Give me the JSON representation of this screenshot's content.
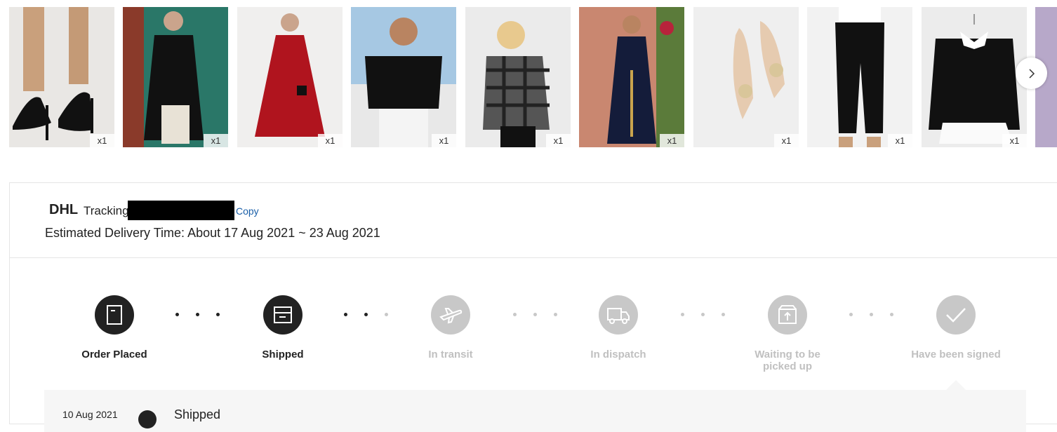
{
  "products": [
    {
      "name": "heels-black",
      "qty": "x1"
    },
    {
      "name": "coat-black-dotted",
      "qty": "x1"
    },
    {
      "name": "cape-dress-red",
      "qty": "x1"
    },
    {
      "name": "pearl-top-black",
      "qty": "x1"
    },
    {
      "name": "plaid-shirt",
      "qty": "x1"
    },
    {
      "name": "embroidered-dress-navy",
      "qty": "x1"
    },
    {
      "name": "pearl-flats",
      "qty": "x1"
    },
    {
      "name": "pants-black",
      "qty": "x1"
    },
    {
      "name": "collar-blouse",
      "qty": "x1"
    }
  ],
  "tracking": {
    "carrier": "DHL",
    "label": "Tracking",
    "copy_label": "Copy",
    "eta": "Estimated Delivery Time: About 17 Aug 2021 ~ 23 Aug 2021"
  },
  "steps": [
    {
      "label": "Order Placed",
      "state": "done",
      "icon": "document-icon"
    },
    {
      "label": "Shipped",
      "state": "done",
      "icon": "box-icon"
    },
    {
      "label": "In transit",
      "state": "todo",
      "icon": "airplane-icon"
    },
    {
      "label": "In dispatch",
      "state": "todo",
      "icon": "truck-icon"
    },
    {
      "label": "Waiting to be picked up",
      "state": "todo",
      "icon": "package-up-icon"
    },
    {
      "label": "Have been signed",
      "state": "todo",
      "icon": "checkmark-icon"
    }
  ],
  "history": [
    {
      "date": "10 Aug 2021",
      "status": "Shipped"
    }
  ],
  "colors": {
    "done": "#222222",
    "todo": "#c8c8c8",
    "link": "#1a5fa8"
  }
}
